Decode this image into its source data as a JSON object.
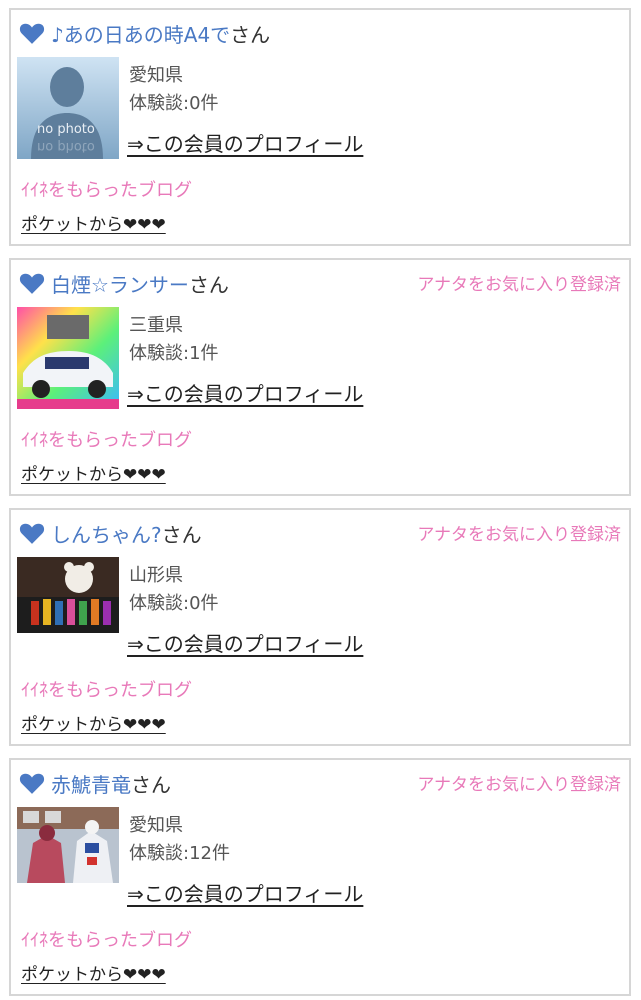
{
  "members": [
    {
      "name": "♪あの日あの時A4で",
      "suffix": "さん",
      "favorite_badge": "",
      "photo": "no-photo",
      "photo_text": "no photo",
      "prefecture": "愛知県",
      "experiences": "体験談:0件",
      "profile_link": "⇒この会員のプロフィール",
      "liked_blog": "ｲｲﾈをもらったブログ",
      "pocket": "ポケットから❤❤❤"
    },
    {
      "name": "白煙☆ランサー",
      "suffix": "さん",
      "favorite_badge": "アナタをお気に入り登録済",
      "photo": "car-photo",
      "photo_text": "",
      "prefecture": "三重県",
      "experiences": "体験談:1件",
      "profile_link": "⇒この会員のプロフィール",
      "liked_blog": "ｲｲﾈをもらったブログ",
      "pocket": "ポケットから❤❤❤"
    },
    {
      "name": "しんちゃん?",
      "suffix": "さん",
      "favorite_badge": "アナタをお気に入り登録済",
      "photo": "toys-photo",
      "photo_text": "",
      "prefecture": "山形県",
      "experiences": "体験談:0件",
      "profile_link": "⇒この会員のプロフィール",
      "liked_blog": "ｲｲﾈをもらったブログ",
      "pocket": "ポケットから❤❤❤"
    },
    {
      "name": "赤鯱青竜",
      "suffix": "さん",
      "favorite_badge": "アナタをお気に入り登録済",
      "photo": "robot-statue-photo",
      "photo_text": "",
      "prefecture": "愛知県",
      "experiences": "体験談:12件",
      "profile_link": "⇒この会員のプロフィール",
      "liked_blog": "ｲｲﾈをもらったブログ",
      "pocket": "ポケットから❤❤❤"
    }
  ],
  "colors": {
    "name_link": "#4a79c4",
    "heart": "#4a79c4",
    "pink_text": "#e879b9",
    "card_border": "#d6d6d6"
  },
  "icons": {
    "member_heart": "heart-icon"
  }
}
